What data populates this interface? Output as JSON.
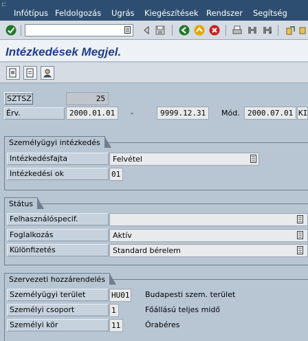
{
  "menu": {
    "items": [
      "Infótípus",
      "Feldolgozás",
      "Ugrás",
      "Kiegészítések",
      "Rendszer",
      "Segítség"
    ]
  },
  "toolbar": {
    "command_value": "",
    "icons": [
      "enter-check-icon",
      "command-dropdown-icon",
      "back-arrow-icon",
      "save-icon",
      "back-green-icon",
      "exit-yellow-icon",
      "cancel-red-icon",
      "print-icon",
      "find-icon",
      "find-next-icon",
      "first-page-icon"
    ]
  },
  "title": "Intézkedések Megjel.",
  "app_toolbar": {
    "icons": [
      "copy-record-icon",
      "display-record-icon",
      "person-overview-icon"
    ]
  },
  "header": {
    "sztsz_label": "SZTSZ",
    "sztsz_value": "25",
    "erv_label": "Érv.",
    "erv_from": "2000.01.01",
    "dash": "-",
    "erv_to": "9999.12.31",
    "mod_label": "Mód.",
    "mod_value": "2000.07.01",
    "mod_suffix": "KI"
  },
  "group_personal_action": {
    "title": "Személyügyi intézkedés",
    "fields": [
      {
        "label": "Intézkedésfajta",
        "value": "Felvétel"
      },
      {
        "label": "Intézkedési ok",
        "value": "01"
      }
    ]
  },
  "group_status": {
    "title": "Státus",
    "fields": [
      {
        "label": "Felhasználóspecif.",
        "value": ""
      },
      {
        "label": "Foglalkozás",
        "value": "Aktív"
      },
      {
        "label": "Különfizetés",
        "value": "Standard bérelem"
      }
    ]
  },
  "group_org": {
    "title": "Szervezeti hozzárendelés",
    "fields": [
      {
        "label": "Személyügyi terület",
        "code": "HU01",
        "text": "Budapesti szem. terület"
      },
      {
        "label": "Személyi csoport",
        "code": "1",
        "text": "Főállású teljes midő"
      },
      {
        "label": "Személyi kör",
        "code": "11",
        "text": "Órabéres"
      }
    ]
  },
  "colors": {
    "menubar": "#2d4e71",
    "title_text": "#1e3f8a",
    "background": "#b8c6d4"
  }
}
